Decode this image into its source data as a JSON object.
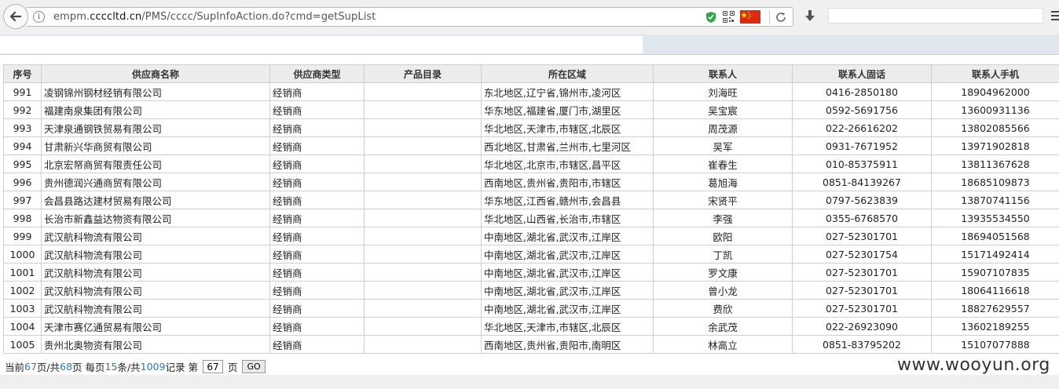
{
  "browser": {
    "url_prefix": "empm.",
    "url_domain": "ccccltd.cn",
    "url_path": "/PMS/cccc/SupInfoAction.do?cmd=getSupList"
  },
  "table": {
    "headers": [
      "序号",
      "供应商名称",
      "供应商类型",
      "产品目录",
      "所在区域",
      "联系人",
      "联系人固话",
      "联系人手机"
    ],
    "rows": [
      [
        "991",
        "凌钢锦州钢材经销有限公司",
        "经销商",
        "",
        "东北地区,辽宁省,锦州市,凌河区",
        "刘海旺",
        "0416-2850180",
        "18904962000"
      ],
      [
        "992",
        "福建南泉集团有限公司",
        "经销商",
        "",
        "华东地区,福建省,厦门市,湖里区",
        "吴宝宸",
        "0592-5691756",
        "13600931136"
      ],
      [
        "993",
        "天津泉通钢铁贸易有限公司",
        "经销商",
        "",
        "华北地区,天津市,市辖区,北辰区",
        "周茂源",
        "022-26616202",
        "13802085566"
      ],
      [
        "994",
        "甘肃新兴华商贸有限公司",
        "经销商",
        "",
        "西北地区,甘肃省,兰州市,七里河区",
        "吴军",
        "0931-7671952",
        "13971902818"
      ],
      [
        "995",
        "北京宏帑商贸有限责任公司",
        "经销商",
        "",
        "华北地区,北京市,市辖区,昌平区",
        "崔春生",
        "010-85375911",
        "13811367628"
      ],
      [
        "996",
        "贵州德润兴通商贸有限公司",
        "经销商",
        "",
        "西南地区,贵州省,贵阳市,市辖区",
        "葛旭海",
        "0851-84139267",
        "18685109873"
      ],
      [
        "997",
        "会昌县路达建材贸易有限公司",
        "经销商",
        "",
        "华东地区,江西省,赣州市,会昌县",
        "宋贤平",
        "0797-5623839",
        "13870741156"
      ],
      [
        "998",
        "长治市新鑫益达物资有限公司",
        "经销商",
        "",
        "华北地区,山西省,长治市,市辖区",
        "李强",
        "0355-6768570",
        "13935534550"
      ],
      [
        "999",
        "武汉航科物流有限公司",
        "经销商",
        "",
        "中南地区,湖北省,武汉市,江岸区",
        "欧阳",
        "027-52301701",
        "18694051568"
      ],
      [
        "1000",
        "武汉航科物流有限公司",
        "经销商",
        "",
        "中南地区,湖北省,武汉市,江岸区",
        "丁凯",
        "027-52301754",
        "15171492414"
      ],
      [
        "1001",
        "武汉航科物流有限公司",
        "经销商",
        "",
        "中南地区,湖北省,武汉市,江岸区",
        "罗文康",
        "027-52301701",
        "15907107835"
      ],
      [
        "1002",
        "武汉航科物流有限公司",
        "经销商",
        "",
        "中南地区,湖北省,武汉市,江岸区",
        "曾小龙",
        "027-52301701",
        "18064116618"
      ],
      [
        "1003",
        "武汉航科物流有限公司",
        "经销商",
        "",
        "中南地区,湖北省,武汉市,江岸区",
        "费欣",
        "027-52301701",
        "18827629557"
      ],
      [
        "1004",
        "天津市赛亿通贸易有限公司",
        "经销商",
        "",
        "华北地区,天津市,市辖区,北辰区",
        "余武茂",
        "022-26923090",
        "13602189255"
      ],
      [
        "1005",
        "贵州北奥物资有限公司",
        "经销商",
        "",
        "西南地区,贵州省,贵阳市,南明区",
        "林高立",
        "0851-83795202",
        "15107077888"
      ]
    ]
  },
  "pager": {
    "t1": "当前",
    "current_page": "67",
    "t2": "页/共",
    "total_pages": "68",
    "t3": "页 每页",
    "per_page": "15",
    "t4": "条/共",
    "total_records": "1009",
    "t5": "记录 第",
    "input_value": "67",
    "t6": "页",
    "go_label": "GO"
  },
  "watermark": "www.wooyun.org"
}
